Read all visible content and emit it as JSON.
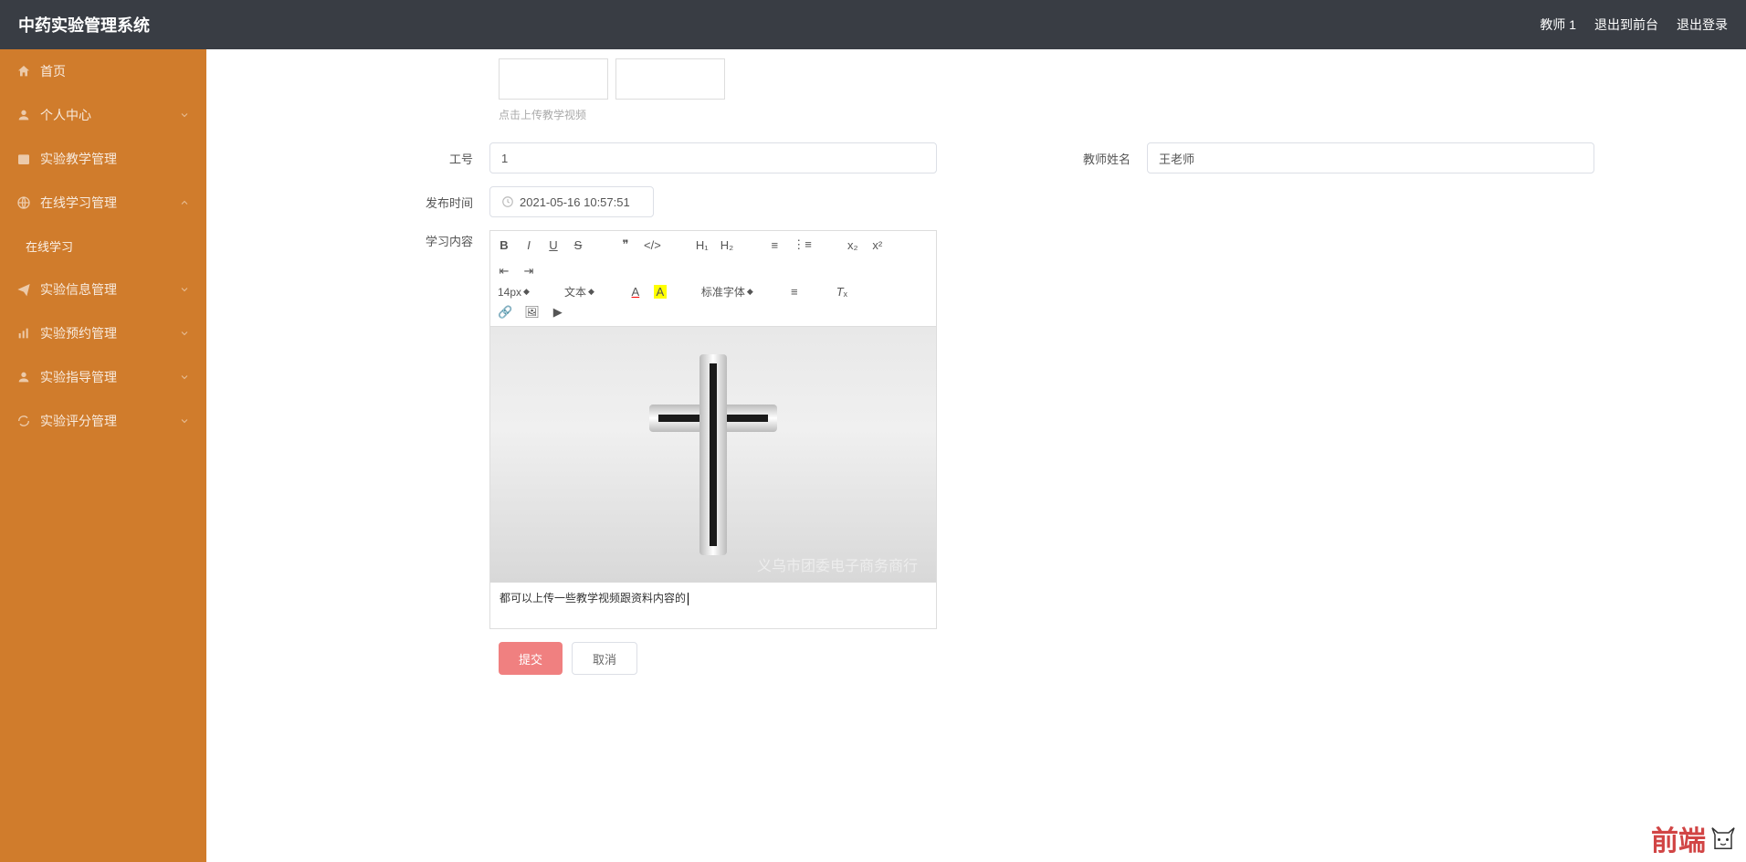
{
  "header": {
    "title": "中药实验管理系统",
    "user": "教师 1",
    "back_to_front": "退出到前台",
    "logout": "退出登录"
  },
  "sidebar": {
    "home": "首页",
    "personal": "个人中心",
    "teaching": "实验教学管理",
    "online_study_mgmt": "在线学习管理",
    "online_study": "在线学习",
    "info": "实验信息管理",
    "reservation": "实验预约管理",
    "guidance": "实验指导管理",
    "scoring": "实验评分管理"
  },
  "form": {
    "upload_hint": "点击上传教学视频",
    "job_no_label": "工号",
    "job_no_value": "1",
    "teacher_name_label": "教师姓名",
    "teacher_name_value": "王老师",
    "publish_time_label": "发布时间",
    "publish_time_value": "2021-05-16 10:57:51",
    "content_label": "学习内容"
  },
  "editor": {
    "font_size": "14px",
    "text_type": "文本",
    "font_family": "标准字体",
    "watermark": "义乌市团委电子商务商行",
    "body_text": "都可以上传一些教学视频跟资料内容的"
  },
  "actions": {
    "submit": "提交",
    "cancel": "取消"
  },
  "footer_logo": "前端"
}
